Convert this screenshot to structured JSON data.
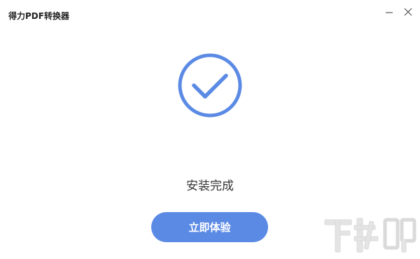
{
  "window": {
    "title": "得力PDF转换器",
    "minimize_icon": "minimize-icon",
    "close_icon": "close-icon"
  },
  "main": {
    "check_icon": "check-circle-icon",
    "status_text": "安装完成",
    "action_label": "立即体验"
  },
  "watermark": {
    "text": "下载吧"
  },
  "colors": {
    "accent": "#5b8ae5",
    "title_text": "#222222",
    "status_text": "#333333",
    "background": "#ffffff"
  }
}
